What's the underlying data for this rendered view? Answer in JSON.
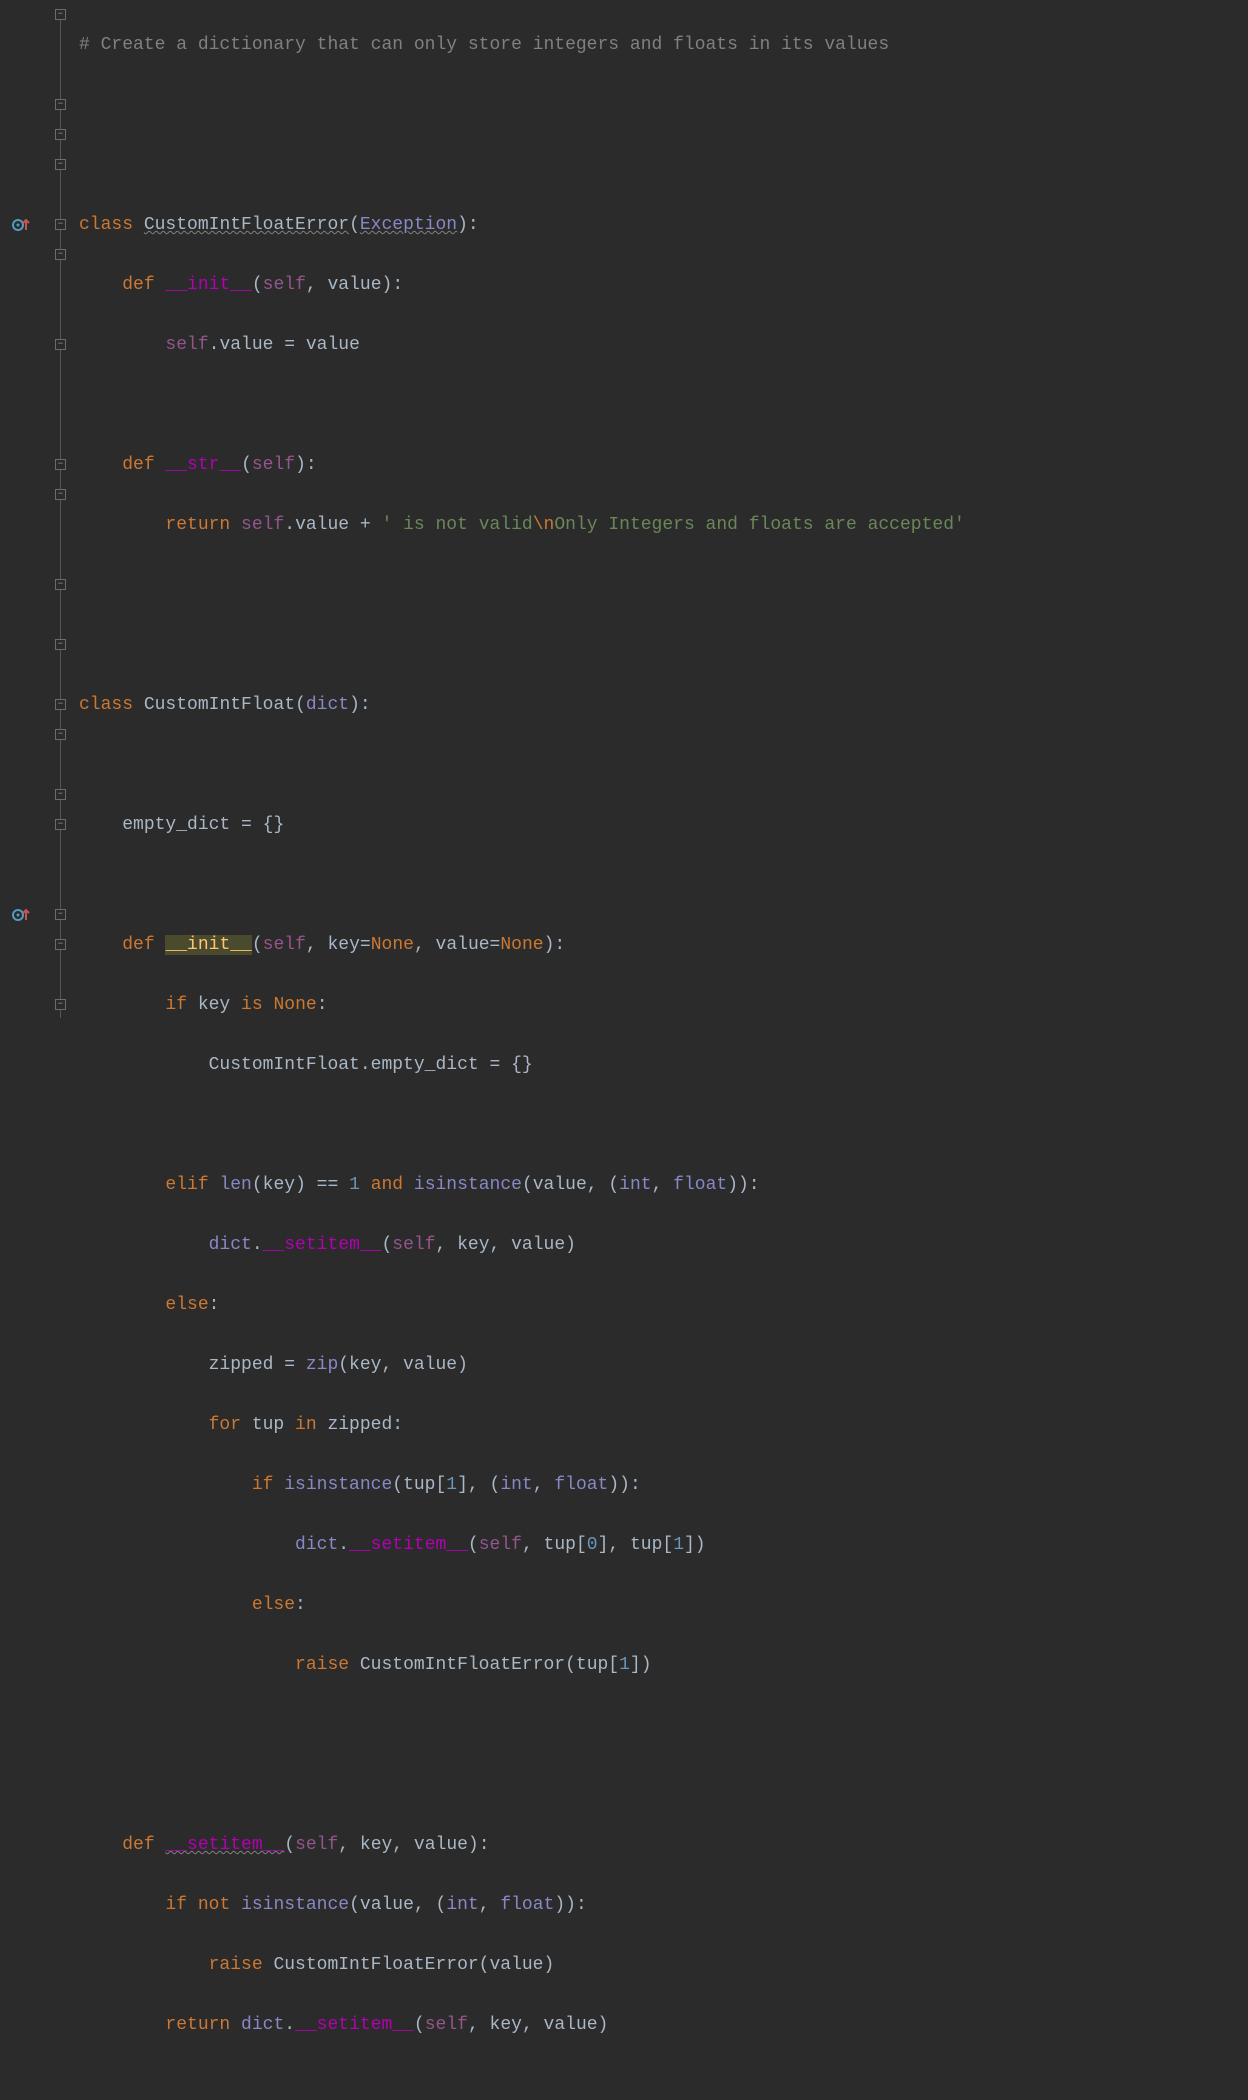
{
  "code": {
    "l1_comment": "# Create a dictionary that can only store integers and floats in its values",
    "l4_class": "class",
    "l4_name": "CustomIntFloatError",
    "l4_base": "Exception",
    "l5_def": "def",
    "l5_name": "__init__",
    "l5_self": "self",
    "l5_p1": "value",
    "l6_self": "self",
    "l6_attr": ".value = value",
    "l8_def": "def",
    "l8_name": "__str__",
    "l8_self": "self",
    "l9_return": "return",
    "l9_self": "self",
    "l9_attr": ".value + ",
    "l9_str1": "' is not valid",
    "l9_escape": "\\n",
    "l9_str2": "Only Integers and floats are accepted'",
    "l12_class": "class",
    "l12_name": "CustomIntFloat",
    "l12_base": "dict",
    "l14_line": "empty_dict = {}",
    "l16_def": "def",
    "l16_name": "__init__",
    "l16_self": "self",
    "l16_params": "key=",
    "l16_none1": "None",
    "l16_comma": ", value=",
    "l16_none2": "None",
    "l17_if": "if",
    "l17_cond1": " key ",
    "l17_is": "is",
    "l17_none": "None",
    "l18_line": "CustomIntFloat.empty_dict = {}",
    "l20_elif": "elif",
    "l20_len": "len",
    "l20_cond1": "(key) == ",
    "l20_num1": "1",
    "l20_and": " and ",
    "l20_isinstance": "isinstance",
    "l20_cond2": "(value, (",
    "l20_int": "int",
    "l20_comma": ", ",
    "l20_float": "float",
    "l20_end": ")):",
    "l21_dict": "dict",
    "l21_dot": ".",
    "l21_setitem": "__setitem__",
    "l21_args": "(",
    "l21_self": "self",
    "l21_rest": ", key, value)",
    "l22_else": "else",
    "l23_zipped": "zipped = ",
    "l23_zip": "zip",
    "l23_args": "(key, value)",
    "l24_for": "for",
    "l24_var": " tup ",
    "l24_in": "in",
    "l24_iter": " zipped:",
    "l25_if": "if",
    "l25_isinstance": "isinstance",
    "l25_arg1": "(tup[",
    "l25_idx1": "1",
    "l25_arg2": "], (",
    "l25_int": "int",
    "l25_comma": ", ",
    "l25_float": "float",
    "l25_end": ")):",
    "l26_dict": "dict",
    "l26_dot": ".",
    "l26_setitem": "__setitem__",
    "l26_args1": "(",
    "l26_self": "self",
    "l26_args2": ", tup[",
    "l26_idx0": "0",
    "l26_args3": "], tup[",
    "l26_idx1": "1",
    "l26_args4": "])",
    "l27_else": "else",
    "l28_raise": "raise",
    "l28_cls": " CustomIntFloatError(tup[",
    "l28_idx": "1",
    "l28_end": "])",
    "l31_def": "def",
    "l31_name": "__setitem__",
    "l31_self": "self",
    "l31_params": ", key, value):",
    "l32_if": "if",
    "l32_not": "not",
    "l32_isinstance": "isinstance",
    "l32_args1": "(value, (",
    "l32_int": "int",
    "l32_comma": ", ",
    "l32_float": "float",
    "l32_end": ")):",
    "l33_raise": "raise",
    "l33_rest": " CustomIntFloatError(value)",
    "l34_return": "return",
    "l34_dict": "dict",
    "l34_dot": ".",
    "l34_setitem": "__setitem__",
    "l34_args1": "(",
    "l34_self": "self",
    "l34_args2": ", key, value)"
  },
  "gutter": {
    "override_rows": [
      7,
      30
    ],
    "fold_marks": [
      {
        "row": 0,
        "type": "open"
      },
      {
        "row": 3,
        "type": "open"
      },
      {
        "row": 4,
        "type": "open"
      },
      {
        "row": 5,
        "type": "close"
      },
      {
        "row": 7,
        "type": "open"
      },
      {
        "row": 8,
        "type": "close"
      },
      {
        "row": 11,
        "type": "open"
      },
      {
        "row": 15,
        "type": "open"
      },
      {
        "row": 16,
        "type": "open"
      },
      {
        "row": 19,
        "type": "open"
      },
      {
        "row": 21,
        "type": "open"
      },
      {
        "row": 23,
        "type": "open"
      },
      {
        "row": 24,
        "type": "open"
      },
      {
        "row": 26,
        "type": "open"
      },
      {
        "row": 27,
        "type": "close"
      },
      {
        "row": 30,
        "type": "open"
      },
      {
        "row": 31,
        "type": "open"
      },
      {
        "row": 33,
        "type": "close"
      }
    ]
  }
}
